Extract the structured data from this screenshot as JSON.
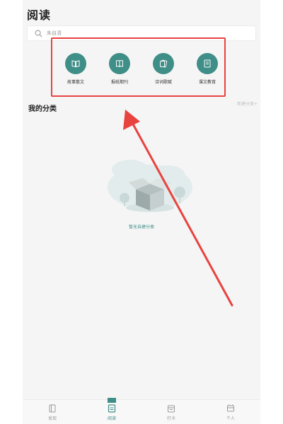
{
  "header": {
    "title": "阅读"
  },
  "search": {
    "placeholder": "朱自清"
  },
  "categories": [
    {
      "label": "故事散文",
      "icon": "open-book-icon"
    },
    {
      "label": "报纸期刊",
      "icon": "book-icon"
    },
    {
      "label": "诗词歌赋",
      "icon": "scroll-icon"
    },
    {
      "label": "课文教育",
      "icon": "notebook-icon"
    }
  ],
  "my_category": {
    "title": "我的分类",
    "new_label": "新建分类+"
  },
  "empty_state": {
    "text": "暂无自建分类"
  },
  "tabbar": {
    "items": [
      {
        "label": "发现",
        "active": false
      },
      {
        "label": "阅读",
        "active": true
      },
      {
        "label": "打卡",
        "active": false
      },
      {
        "label": "个人",
        "active": false
      }
    ]
  },
  "colors": {
    "accent": "#3f8e87",
    "annotation_red": "#e8433f",
    "background": "#f5f5f5"
  }
}
